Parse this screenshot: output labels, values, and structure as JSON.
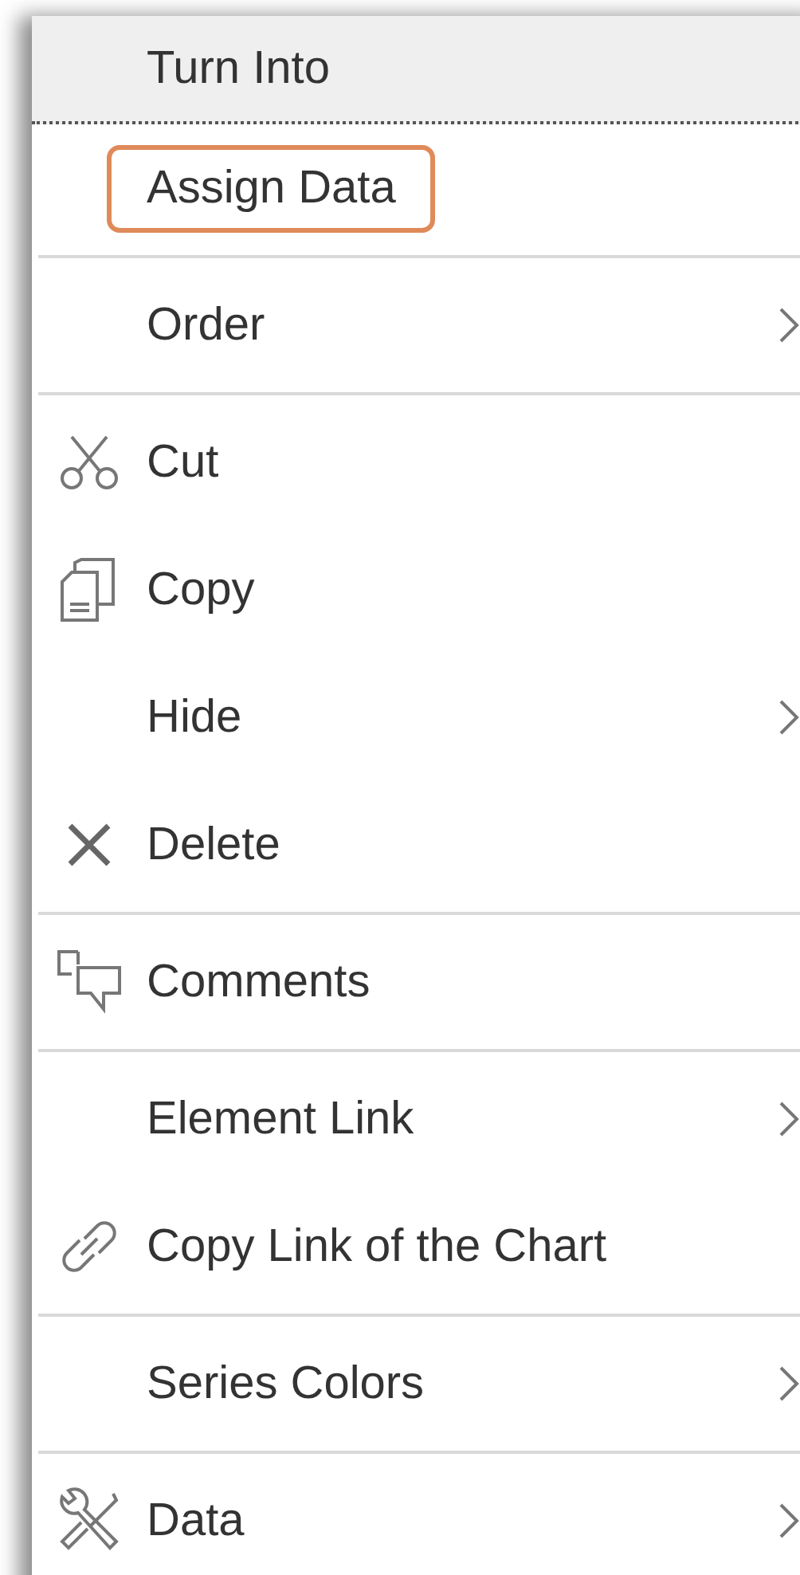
{
  "menu": {
    "groups": [
      {
        "items": [
          {
            "label": "Turn Into",
            "hovered": true,
            "highlighted": false,
            "submenu": false
          },
          {
            "label": "Assign Data",
            "hovered": false,
            "highlighted": true,
            "submenu": false
          }
        ]
      },
      {
        "items": [
          {
            "label": "Order",
            "hovered": false,
            "highlighted": false,
            "submenu": true
          }
        ]
      },
      {
        "items": [
          {
            "label": "Cut",
            "hovered": false,
            "highlighted": false,
            "submenu": false
          },
          {
            "label": "Copy",
            "hovered": false,
            "highlighted": false,
            "submenu": false
          },
          {
            "label": "Hide",
            "hovered": false,
            "highlighted": false,
            "submenu": true
          },
          {
            "label": "Delete",
            "hovered": false,
            "highlighted": false,
            "submenu": false
          }
        ]
      },
      {
        "items": [
          {
            "label": "Comments",
            "hovered": false,
            "highlighted": false,
            "submenu": false
          }
        ]
      },
      {
        "items": [
          {
            "label": "Element Link",
            "hovered": false,
            "highlighted": false,
            "submenu": true
          },
          {
            "label": "Copy Link of the Chart",
            "hovered": false,
            "highlighted": false,
            "submenu": false
          }
        ]
      },
      {
        "items": [
          {
            "label": "Series Colors",
            "hovered": false,
            "highlighted": false,
            "submenu": true
          }
        ]
      },
      {
        "items": [
          {
            "label": "Data",
            "hovered": false,
            "highlighted": false,
            "submenu": true
          }
        ]
      }
    ]
  }
}
